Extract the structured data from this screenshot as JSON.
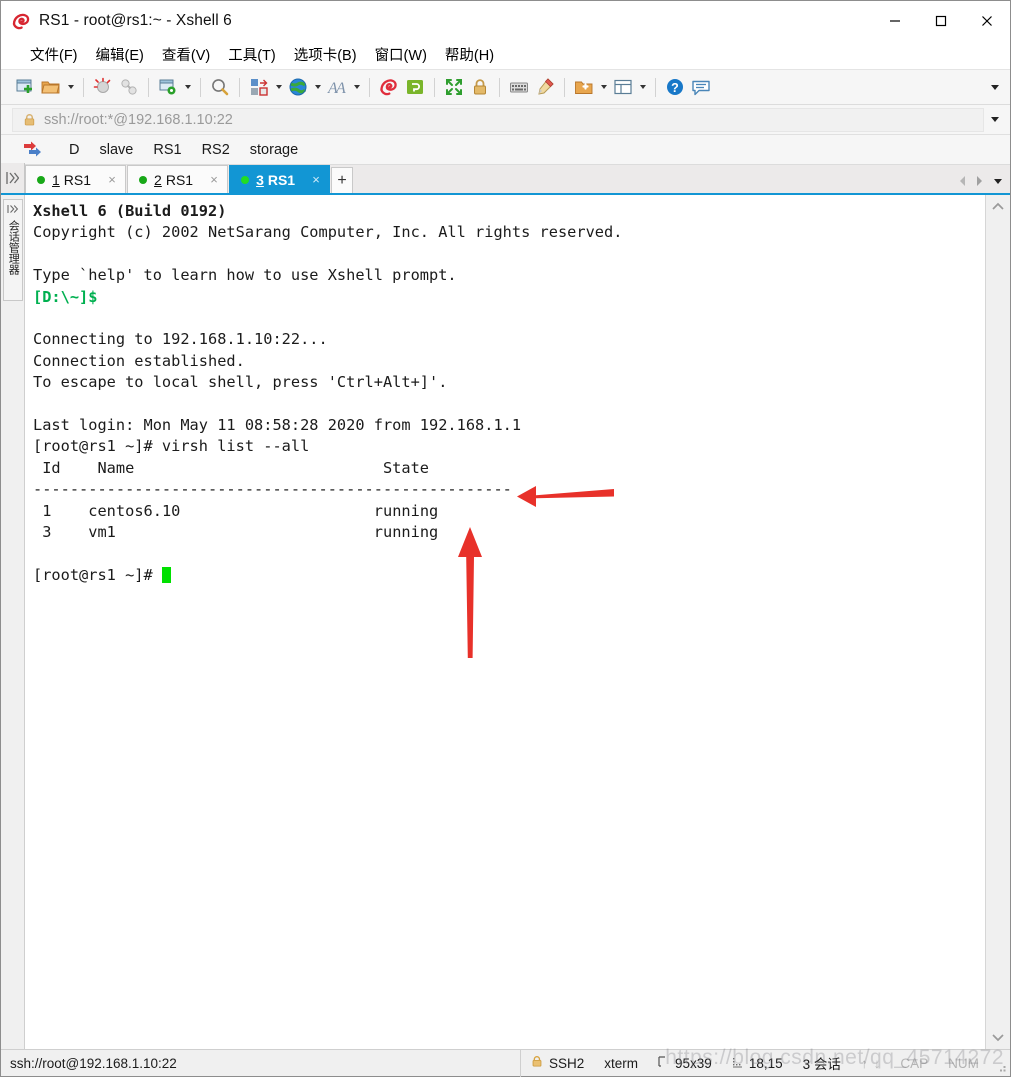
{
  "window": {
    "title": "RS1 - root@rs1:~ - Xshell 6",
    "logo_icon": "xshell-logo-icon",
    "minimize_label": "─",
    "maximize_label": "□",
    "close_label": "✕"
  },
  "menubar": {
    "items": [
      {
        "label": "文件(F)",
        "name": "menu-file"
      },
      {
        "label": "编辑(E)",
        "name": "menu-edit"
      },
      {
        "label": "查看(V)",
        "name": "menu-view"
      },
      {
        "label": "工具(T)",
        "name": "menu-tools"
      },
      {
        "label": "选项卡(B)",
        "name": "menu-tabs"
      },
      {
        "label": "窗口(W)",
        "name": "menu-window"
      },
      {
        "label": "帮助(H)",
        "name": "menu-help"
      }
    ]
  },
  "toolbar": {
    "icons": [
      "new-session-icon",
      "open-folder-icon",
      "caret",
      "separator",
      "disconnect-icon",
      "reconnect-icon",
      "separator",
      "session-properties-icon",
      "caret",
      "separator",
      "find-icon",
      "separator",
      "layout-icon",
      "caret",
      "globe-icon",
      "caret",
      "font-icon",
      "caret",
      "separator",
      "xshell-icon",
      "xftp-icon",
      "separator",
      "fullscreen-icon",
      "lock-icon",
      "separator",
      "keyboard-icon",
      "highlight-icon",
      "separator",
      "new-folder-icon",
      "caret",
      "split-view-icon",
      "caret",
      "separator",
      "help-icon",
      "chat-icon"
    ],
    "overflow_label": "toolbar-overflow"
  },
  "address_bar": {
    "value": "ssh://root:*@192.168.1.10:22",
    "lock_icon": "lock-icon",
    "dropdown_icon": "chevron-down-icon"
  },
  "quickbar": {
    "icon": "quick-connect-icon",
    "items": [
      {
        "label": "D",
        "name": "quickbar-item-d"
      },
      {
        "label": "slave",
        "name": "quickbar-item-slave"
      },
      {
        "label": "RS1",
        "name": "quickbar-item-rs1"
      },
      {
        "label": "RS2",
        "name": "quickbar-item-rs2"
      },
      {
        "label": "storage",
        "name": "quickbar-item-storage"
      }
    ]
  },
  "tabs": {
    "vertical_toggle_icon": "panel-toggle-icon",
    "items": [
      {
        "num": "1",
        "label": "RS1",
        "active": false,
        "status": "connected"
      },
      {
        "num": "2",
        "label": "RS1",
        "active": false,
        "status": "connected"
      },
      {
        "num": "3",
        "label": "RS1",
        "active": true,
        "status": "connected"
      }
    ],
    "add_label": "+",
    "close_label": "×",
    "nav_prev_icon": "chevron-left-icon",
    "nav_next_icon": "chevron-right-icon",
    "nav_list_icon": "chevron-down-icon"
  },
  "sidebar": {
    "session_manager_glyph": "⏩",
    "session_manager_label": "会话管理器"
  },
  "terminal": {
    "line_banner": "Xshell 6 (Build 0192)",
    "line_copyright": "Copyright (c) 2002 NetSarang Computer, Inc. All rights reserved.",
    "line_blank1": "",
    "line_help": "Type `help' to learn how to use Xshell prompt.",
    "line_localprompt": "[D:\\~]$",
    "line_blank2": "",
    "line_connecting": "Connecting to 192.168.1.10:22...",
    "line_established": "Connection established.",
    "line_escape": "To escape to local shell, press 'Ctrl+Alt+]'.",
    "line_blank3": "",
    "line_lastlogin": "Last login: Mon May 11 08:58:28 2020 from 192.168.1.1",
    "line_command": "[root@rs1 ~]# virsh list --all",
    "line_header": " Id    Name                           State",
    "line_rule": "----------------------------------------------------",
    "vm_rows": [
      {
        "id": " 1",
        "name": "centos6.10",
        "state": "running"
      },
      {
        "id": " 3",
        "name": "vm1",
        "state": "running"
      }
    ],
    "line_blank4": "",
    "line_prompt": "[root@rs1 ~]# ",
    "cursor": "block-cursor"
  },
  "annotations": {
    "arrow_left_name": "red-arrow-pointing-left",
    "arrow_up_name": "red-arrow-pointing-up",
    "color": "#e8312a"
  },
  "scrollbar": {
    "up_icon": "scroll-up-arrow-icon",
    "down_icon": "scroll-down-arrow-icon"
  },
  "statusbar": {
    "url": "ssh://root@192.168.1.10:22",
    "protocol_icon": "lock-icon",
    "protocol": "SSH2",
    "terminal_type": "xterm",
    "size_icon": "size-icon",
    "size": "95x39",
    "cursor_icon": "cursor-pos-icon",
    "cursor_pos": "18,15",
    "sessions": "3 会话",
    "caps": "CAP",
    "num": "NUM",
    "up_arrow": "↑",
    "down_arrow": "↓"
  },
  "watermark": {
    "text": "https://blog.csdn.net/qq_45714272"
  }
}
